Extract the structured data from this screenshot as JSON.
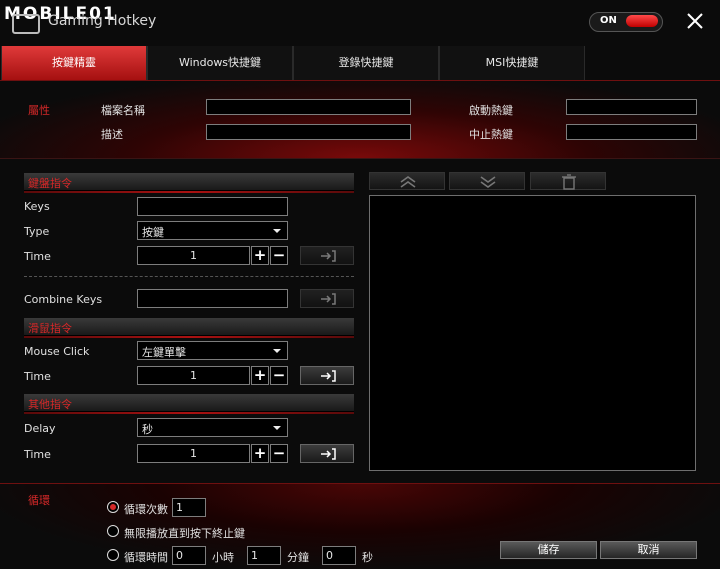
{
  "header": {
    "logo_text": "MOBILE01",
    "app_title": "Gaming Hotkey",
    "power_toggle": {
      "label": "ON",
      "state": "on",
      "color": "#e02020"
    }
  },
  "tabs": [
    {
      "label": "按鍵精靈",
      "active": true
    },
    {
      "label": "Windows快捷鍵",
      "active": false
    },
    {
      "label": "登錄快捷鍵",
      "active": false
    },
    {
      "label": "MSI快捷鍵",
      "active": false
    }
  ],
  "properties": {
    "section_label": "屬性",
    "filename_label": "檔案名稱",
    "filename_value": "",
    "description_label": "描述",
    "description_value": "",
    "start_hotkey_label": "啟動熱鍵",
    "start_hotkey_value": "",
    "stop_hotkey_label": "中止熱鍵",
    "stop_hotkey_value": ""
  },
  "keyboard": {
    "section_label": "鍵盤指令",
    "keys_label": "Keys",
    "keys_value": "",
    "type_label": "Type",
    "type_value": "按鍵",
    "time_label": "Time",
    "time_value": "1",
    "combine_label": "Combine Keys",
    "combine_value": ""
  },
  "mouse": {
    "section_label": "滑鼠指令",
    "click_label": "Mouse Click",
    "click_value": "左鍵單擊",
    "time_label": "Time",
    "time_value": "1"
  },
  "other": {
    "section_label": "其他指令",
    "delay_label": "Delay",
    "delay_value": "秒",
    "time_label": "Time",
    "time_value": "1"
  },
  "loop": {
    "section_label": "循環",
    "opt_count_label": "循環次數",
    "opt_count_value": "1",
    "opt_until_stop_label": "無限播放直到按下終止鍵",
    "opt_time_label": "循環時間",
    "hours_value": "0",
    "hours_label": "小時",
    "minutes_value": "1",
    "minutes_label": "分鐘",
    "seconds_value": "0",
    "seconds_label": "秒",
    "selected": "count"
  },
  "buttons": {
    "save": "儲存",
    "cancel": "取消"
  },
  "colors": {
    "accent_red": "#d42828",
    "tab_active": "#c32020"
  }
}
